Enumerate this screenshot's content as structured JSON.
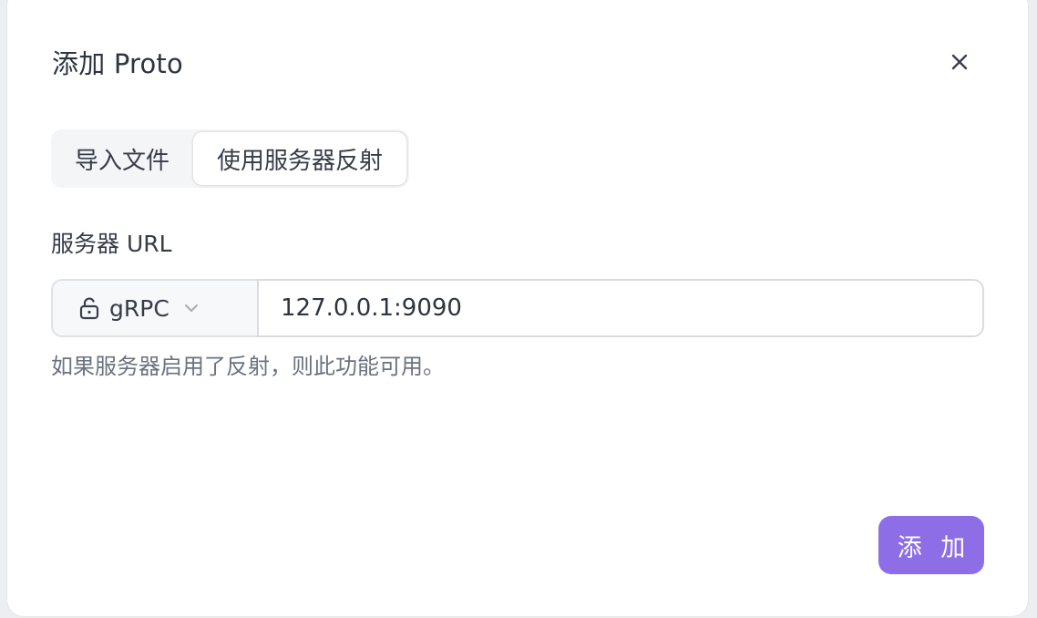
{
  "dialog": {
    "title": "添加 Proto",
    "tabs": [
      {
        "label": "导入文件",
        "active": false
      },
      {
        "label": "使用服务器反射",
        "active": true
      }
    ],
    "field_label": "服务器 URL",
    "protocol": {
      "label": "gRPC",
      "icon": "lock-open-icon"
    },
    "url": {
      "value": "127.0.0.1:9090"
    },
    "hint": "如果服务器启用了反射，则此功能可用。",
    "submit_label": "添 加"
  },
  "colors": {
    "accent": "#8e6ee6",
    "text": "#2f3441",
    "muted": "#6b7280"
  }
}
